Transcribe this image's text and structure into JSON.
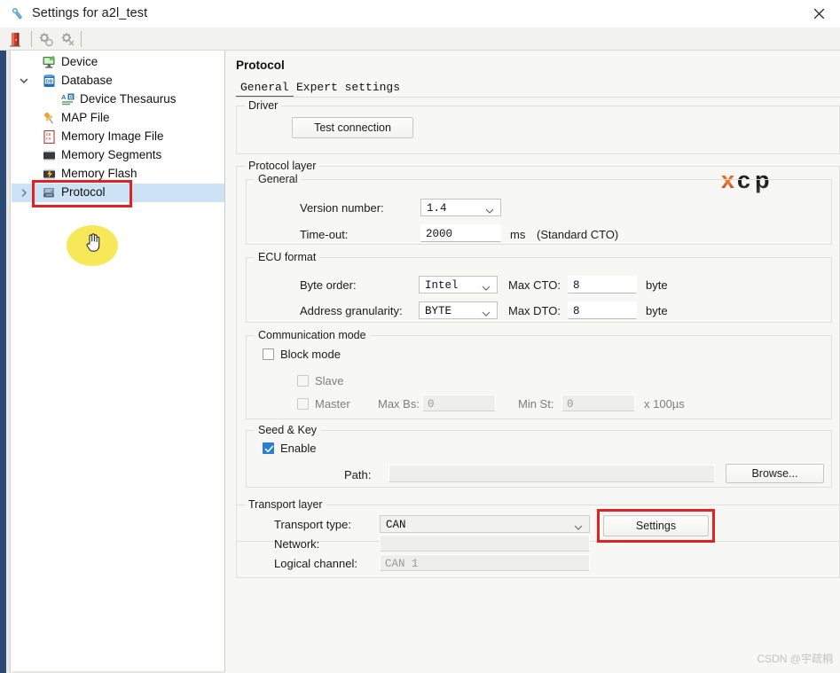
{
  "window": {
    "title": "Settings for a2l_test",
    "title_icon": "wrench-icon",
    "close_label": "✕"
  },
  "toolbar": {
    "buttons": [
      {
        "name": "exit-door-icon",
        "label": ""
      },
      {
        "name": "gear-config-icon",
        "label": ""
      },
      {
        "name": "gear-advanced-icon",
        "label": ""
      }
    ]
  },
  "sidebar": {
    "items": [
      {
        "label": "Device",
        "icon": "monitor-icon",
        "indent": 0,
        "twisty": "none",
        "selected": false
      },
      {
        "label": "Database",
        "icon": "database-icon",
        "indent": 0,
        "twisty": "expanded",
        "selected": false
      },
      {
        "label": "Device Thesaurus",
        "icon": "thesaurus-icon",
        "indent": 1,
        "twisty": "none",
        "selected": false
      },
      {
        "label": "MAP File",
        "icon": "pushpin-icon",
        "indent": 0,
        "twisty": "none",
        "selected": false
      },
      {
        "label": "Memory Image File",
        "icon": "memory-image-icon",
        "indent": 0,
        "twisty": "none",
        "selected": false
      },
      {
        "label": "Memory Segments",
        "icon": "memory-chip-icon",
        "indent": 0,
        "twisty": "none",
        "selected": false
      },
      {
        "label": "Memory Flash",
        "icon": "memory-flash-icon",
        "indent": 0,
        "twisty": "none",
        "selected": false
      },
      {
        "label": "Protocol",
        "icon": "protocol-icon",
        "indent": 0,
        "twisty": "collapsed",
        "selected": true
      }
    ]
  },
  "content": {
    "panel_title": "Protocol",
    "tabs": [
      {
        "label": "General",
        "active": true
      },
      {
        "label": "Expert settings",
        "active": false
      }
    ],
    "logo": "xcp-logo",
    "driver": {
      "group_title": "Driver",
      "test_connection_label": "Test connection"
    },
    "protocol_layer": {
      "group_title": "Protocol layer",
      "general": {
        "group_title": "General",
        "version_label": "Version number:",
        "version_value": "1.4",
        "timeout_label": "Time-out:",
        "timeout_value": "2000",
        "timeout_unit": "ms",
        "timeout_note": "(Standard CTO)"
      },
      "ecu_format": {
        "group_title": "ECU format",
        "byte_order_label": "Byte order:",
        "byte_order_value": "Intel",
        "address_granularity_label": "Address granularity:",
        "address_granularity_value": "BYTE",
        "max_cto_label": "Max CTO:",
        "max_cto_value": "8",
        "max_cto_unit": "byte",
        "max_dto_label": "Max DTO:",
        "max_dto_value": "8",
        "max_dto_unit": "byte"
      },
      "communication_mode": {
        "group_title": "Communication mode",
        "block_mode_label": "Block mode",
        "block_mode_checked": false,
        "slave_label": "Slave",
        "slave_checked": false,
        "master_label": "Master",
        "master_checked": false,
        "max_bs_label": "Max Bs:",
        "max_bs_value": "0",
        "min_st_label": "Min St:",
        "min_st_value": "0",
        "min_st_unit": "x 100µs"
      },
      "seed_key": {
        "group_title": "Seed & Key",
        "enable_label": "Enable",
        "enable_checked": true,
        "path_label": "Path:",
        "path_value": "",
        "browse_label": "Browse..."
      }
    },
    "transport_layer": {
      "group_title": "Transport layer",
      "transport_type_label": "Transport type:",
      "transport_type_value": "CAN",
      "network_label": "Network:",
      "network_value": "",
      "logical_channel_label": "Logical channel:",
      "logical_channel_value": "CAN 1",
      "settings_label": "Settings"
    }
  },
  "annotations": {
    "highlight_color": "#e02222",
    "cursor_highlight_color": "#f5e43c"
  },
  "watermark": {
    "text": "CSDN @宇疏桐"
  }
}
